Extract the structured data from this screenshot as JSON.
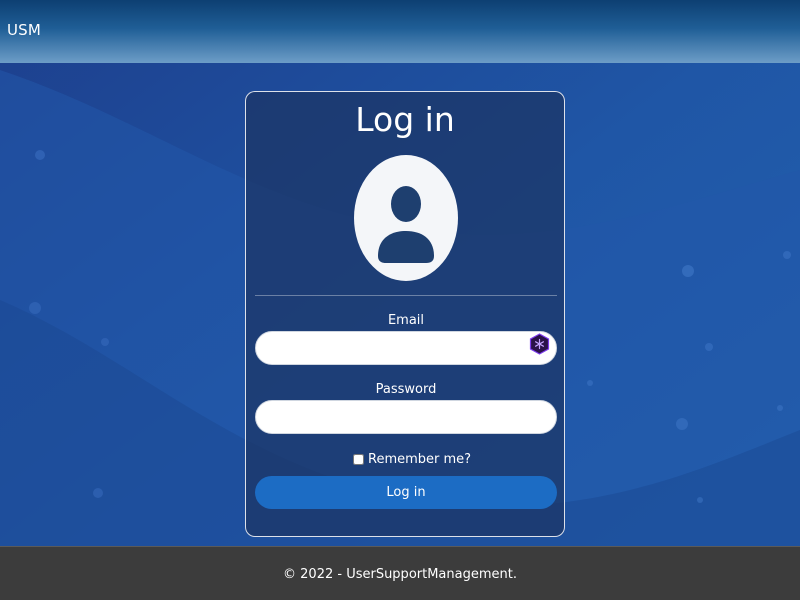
{
  "navbar": {
    "brand": "USM"
  },
  "login_card": {
    "title": "Log in",
    "avatar_icon": "user-avatar-icon",
    "email": {
      "label": "Email",
      "value": "",
      "placeholder": ""
    },
    "password": {
      "label": "Password",
      "value": "",
      "placeholder": ""
    },
    "remember_me": {
      "label": "Remember me?",
      "checked": false
    },
    "submit_label": "Log in"
  },
  "footer": {
    "text": "© 2022 - UserSupportManagement."
  },
  "colors": {
    "background": "#1f4f9a",
    "navbar": "#1f5e96",
    "card": "#1c3464",
    "primary_button": "#1c6cc4",
    "footer": "#3c3c3c",
    "extension_icon": "#7c3aed"
  }
}
